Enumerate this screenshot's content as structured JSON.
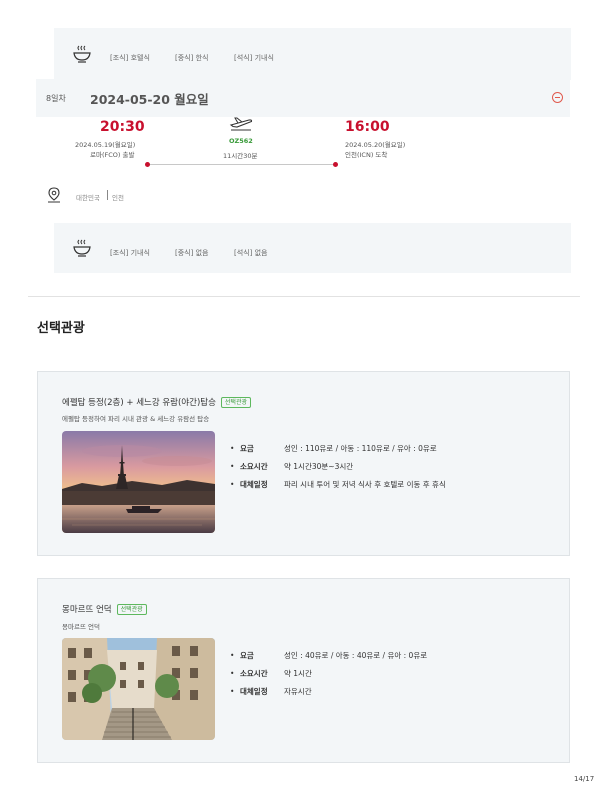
{
  "meals_top": {
    "icon": "meal-bowl-icon",
    "breakfast": "[조식] 호텔식",
    "lunch": "[중식] 한식",
    "dinner": "[석식] 기내식"
  },
  "day": {
    "label": "8일차",
    "date": "2024-05-20 월요일",
    "collapse_icon": "minus-circle-icon"
  },
  "flight": {
    "icon": "airplane-icon",
    "depart_time": "20:30",
    "depart_date": "2024.05.19(월요일)",
    "depart_place": "로마(FCO) 출발",
    "flight_no": "OZ562",
    "duration": "11시간30분",
    "arrive_time": "16:00",
    "arrive_date": "2024.05.20(월요일)",
    "arrive_place": "인천(ICN) 도착",
    "accent": "#c8102e",
    "flight_no_color": "#3a9b3a"
  },
  "location": {
    "icon": "map-pin-icon",
    "country": "대한민국",
    "city": "인천"
  },
  "meals_bottom": {
    "icon": "meal-bowl-icon",
    "breakfast": "[조식] 기내식",
    "lunch": "[중식] 없음",
    "dinner": "[석식] 없음"
  },
  "section_title": "선택관광",
  "tours": [
    {
      "title": "에펠탑 등정(2층) + 세느강 유람(야간)탑승",
      "badge": "선택관광",
      "desc": "에펠탑 등정하여 파리 시내 관광 & 세느강 유람선 탑승",
      "photo": "eiffel-tower-sunset-photo",
      "rows": [
        {
          "key": "요금",
          "value": "성인 : 110유로 / 아동 : 110유로 / 유아 : 0유로"
        },
        {
          "key": "소요시간",
          "value": "약 1시간30분~3시간"
        },
        {
          "key": "대체일정",
          "value": "파리 시내 투어 및 저녁 식사 후 호텔로 이동 후 휴식"
        }
      ]
    },
    {
      "title": "몽마르뜨 언덕",
      "badge": "선택관광",
      "desc": "몽마르뜨 언덕",
      "photo": "montmartre-street-photo",
      "rows": [
        {
          "key": "요금",
          "value": "성인 : 40유로 / 아동 : 40유로 / 유아 : 0유로"
        },
        {
          "key": "소요시간",
          "value": "약 1시간"
        },
        {
          "key": "대체일정",
          "value": "자유시간"
        }
      ]
    }
  ],
  "page": "14/17"
}
